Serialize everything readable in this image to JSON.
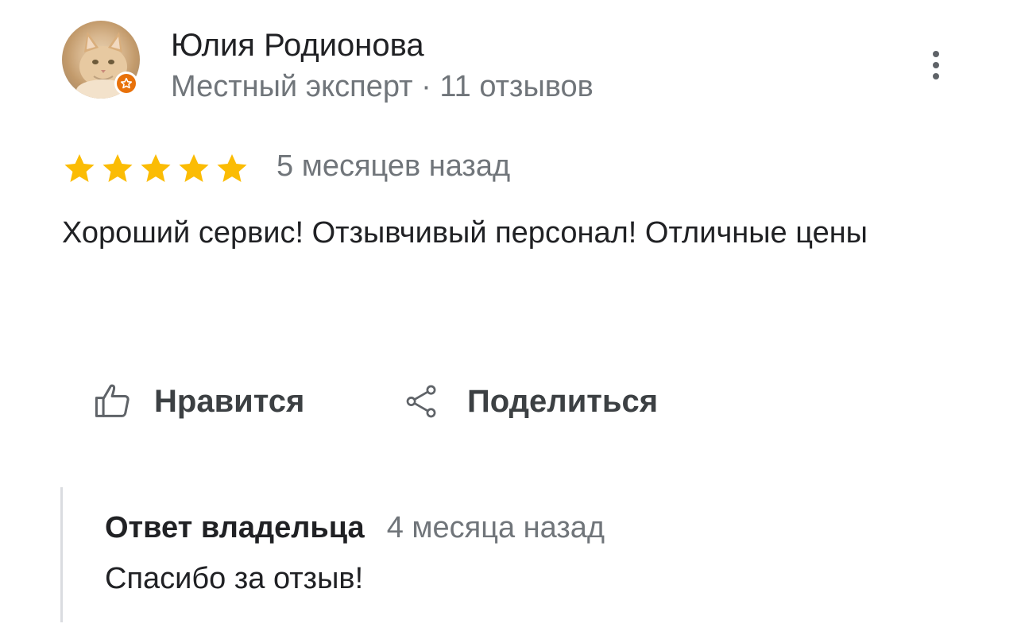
{
  "review": {
    "author": {
      "name": "Юлия Родионова",
      "meta": "Местный эксперт · 11 отзывов",
      "avatar_icon": "cat-photo-avatar",
      "badge_icon": "local-guide-star-icon",
      "badge_color": "#e8710a"
    },
    "more_icon": "more-vertical-icon",
    "rating": 5,
    "rating_max": 5,
    "star_color": "#fbbc04",
    "time": "5 месяцев назад",
    "text": "Хороший сервис! Отзывчивый персонал! Отличные цены"
  },
  "actions": {
    "like_label": "Нравится",
    "like_icon": "thumbs-up-icon",
    "share_label": "Поделиться",
    "share_icon": "share-icon"
  },
  "owner_reply": {
    "title": "Ответ владельца",
    "time": "4 месяца назад",
    "text": "Спасибо за отзыв!"
  }
}
